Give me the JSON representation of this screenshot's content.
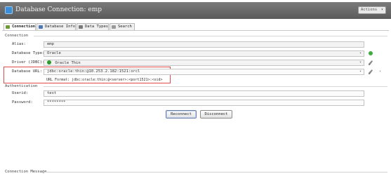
{
  "window": {
    "title": "Database Connection: emp",
    "actions_label": "Actions"
  },
  "tabs": [
    {
      "label": "Connection"
    },
    {
      "label": "Database Info"
    },
    {
      "label": "Data Types"
    },
    {
      "label": "Search"
    }
  ],
  "sections": {
    "connection": "Connection",
    "authentication": "Authentication",
    "message": "Connection Message"
  },
  "connection": {
    "alias_label": "Alias:",
    "alias_value": "emp",
    "dbtype_label": "Database Type:",
    "dbtype_value": "Oracle",
    "driver_label": "Driver (JDBC):",
    "driver_value": "Oracle Thin",
    "url_label": "Database URL:",
    "url_value": "jdbc:oracle:thin:@10.253.2.182:1521:orcl",
    "url_hint": "URL Format: jdbc:oracle:thin:@<server>:<port1521>:<sid>"
  },
  "auth": {
    "userid_label": "Userid:",
    "userid_value": "test",
    "password_label": "Password:",
    "password_value": "********"
  },
  "buttons": {
    "reconnect": "Reconnect",
    "disconnect": "Disconnect"
  },
  "colors": {
    "highlight": "#e04a4a",
    "titlebar": "#6a6a6a",
    "status_ok": "#3fae3f"
  }
}
